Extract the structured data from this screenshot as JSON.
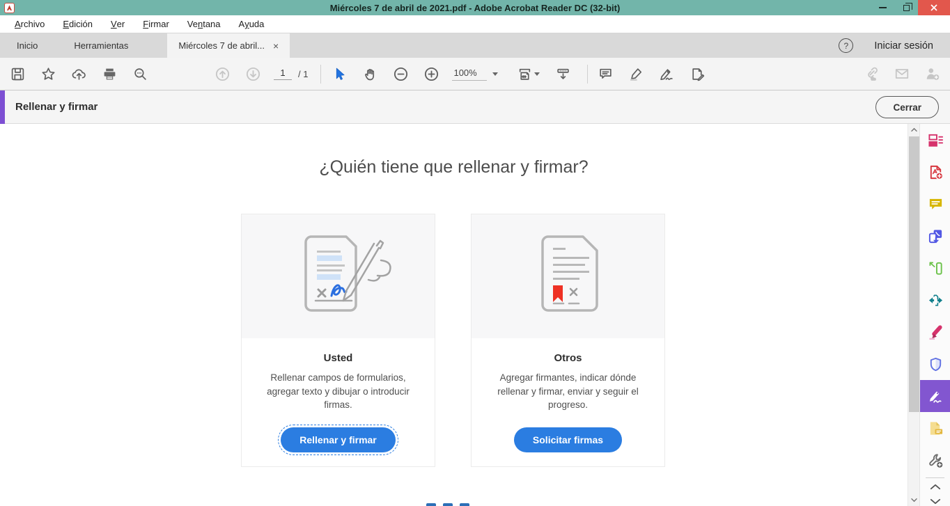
{
  "window": {
    "title": "Miércoles 7 de abril de 2021.pdf - Adobe Acrobat Reader DC (32-bit)",
    "controls": [
      "minimize",
      "restore",
      "close"
    ]
  },
  "menu": {
    "items": [
      {
        "pre": "",
        "key": "A",
        "post": "rchivo"
      },
      {
        "pre": "",
        "key": "E",
        "post": "dición"
      },
      {
        "pre": "",
        "key": "V",
        "post": "er"
      },
      {
        "pre": "",
        "key": "F",
        "post": "irmar"
      },
      {
        "pre": "Ve",
        "key": "n",
        "post": "tana"
      },
      {
        "pre": "A",
        "key": "y",
        "post": "uda"
      }
    ]
  },
  "tabs": {
    "inicio": "Inicio",
    "herramientas": "Herramientas",
    "document": "Miércoles 7 de abril...",
    "close_glyph": "×",
    "help_glyph": "?",
    "sign_in": "Iniciar sesión"
  },
  "toolbar": {
    "page_current": "1",
    "page_total": "/ 1",
    "zoom_level": "100%",
    "icons": [
      "save-icon",
      "star-icon",
      "cloud-upload-icon",
      "print-icon",
      "search-icon",
      "page-up-icon",
      "page-down-icon",
      "select-icon",
      "hand-icon",
      "zoom-out-icon",
      "zoom-in-icon",
      "fit-width-icon",
      "scroll-mode-icon",
      "comment-icon",
      "highlighter-icon",
      "sign-icon",
      "stamp-icon",
      "share-link-icon",
      "email-icon",
      "add-person-icon"
    ]
  },
  "panel_header": {
    "title": "Rellenar y firmar",
    "close_button": "Cerrar"
  },
  "main": {
    "heading": "¿Quién tiene que rellenar y firmar?",
    "cards": [
      {
        "title": "Usted",
        "description": "Rellenar campos de formularios, agregar texto y dibujar o introducir firmas.",
        "button": "Rellenar y firmar"
      },
      {
        "title": "Otros",
        "description": "Agregar firmantes, indicar dónde rellenar y firmar, enviar y seguir el progreso.",
        "button": "Solicitar firmas"
      }
    ]
  },
  "sidebar": {
    "tools": [
      {
        "name": "organize-pages",
        "color": "#d6336c"
      },
      {
        "name": "create-pdf",
        "color": "#d7373f"
      },
      {
        "name": "comments",
        "color": "#d7b600"
      },
      {
        "name": "export-pdf",
        "color": "#5258e4"
      },
      {
        "name": "edit-pdf",
        "color": "#6cc24a"
      },
      {
        "name": "compress-pdf",
        "color": "#107f8c"
      },
      {
        "name": "highlight",
        "color": "#d6336c"
      },
      {
        "name": "protect",
        "color": "#6272e3"
      },
      {
        "name": "fill-and-sign",
        "color": "#8256d0",
        "active": true
      },
      {
        "name": "share-for-comments",
        "color": "#e3c35a"
      },
      {
        "name": "more-tools",
        "color": "#707070"
      }
    ]
  },
  "colors": {
    "titlebar_teal": "#72b5aa",
    "close_red": "#e2574c",
    "accent_purple": "#7d4fd3",
    "button_blue": "#2b7de1"
  }
}
